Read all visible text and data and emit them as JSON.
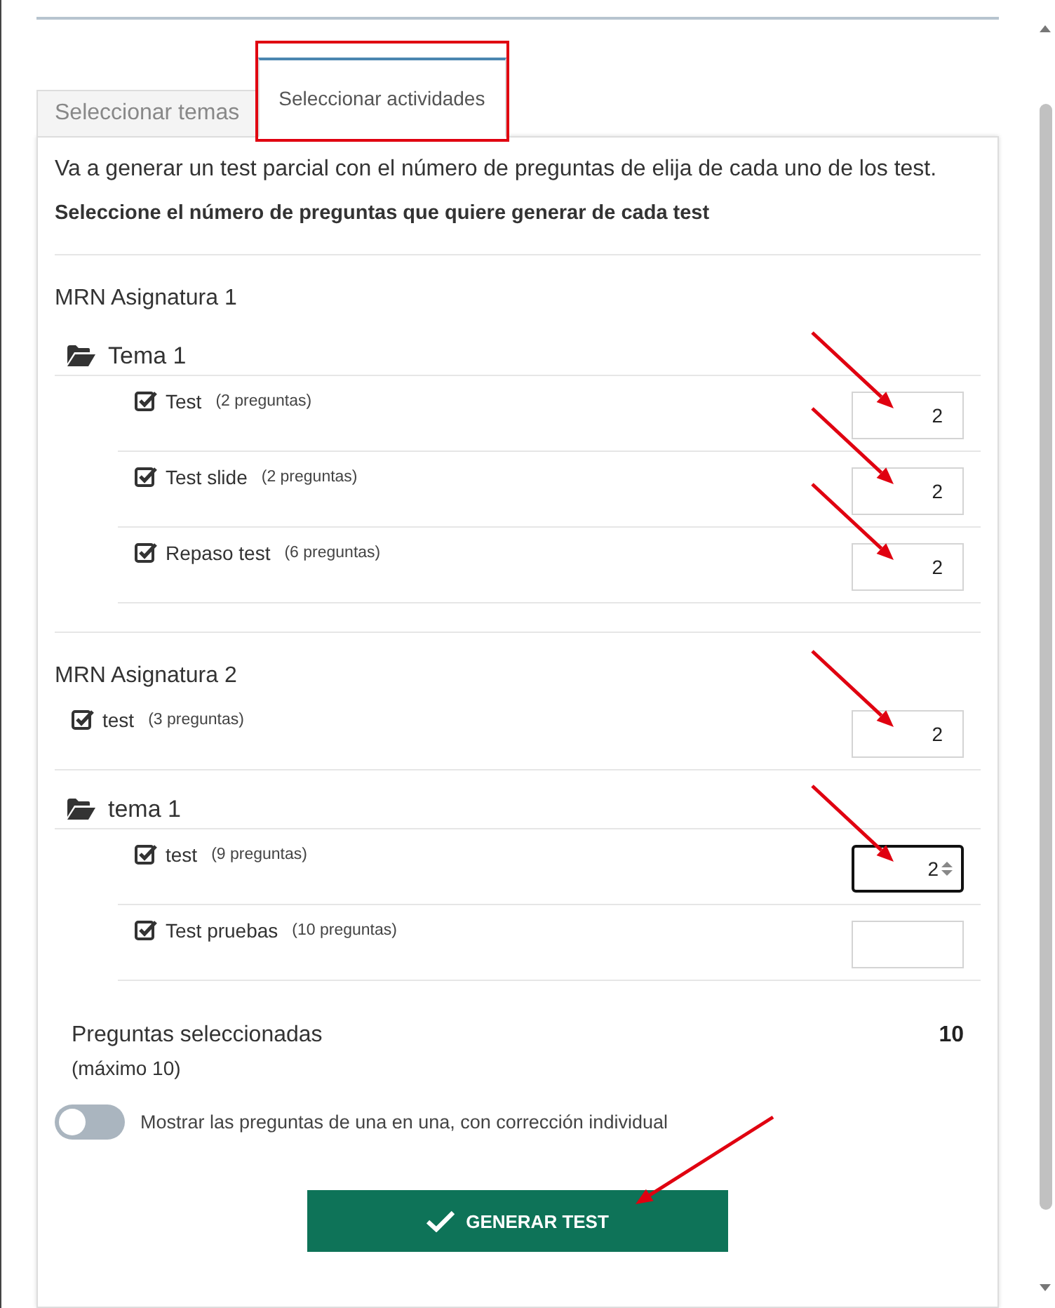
{
  "tabs": [
    {
      "label": "Seleccionar temas",
      "selected": false,
      "highlighted": false
    },
    {
      "label": "Seleccionar actividades",
      "selected": true,
      "highlighted": true
    }
  ],
  "intro": "Va a generar un test parcial con el número de preguntas de elija de cada uno de los test.",
  "instruction": "Seleccione el número de preguntas que quiere generar de cada test",
  "subjects": [
    {
      "title": "MRN Asignatura 1",
      "entries": [
        {
          "kind": "folder",
          "title": "Tema 1",
          "children": [
            {
              "label": "Test",
              "count": "(2 preguntas)",
              "checked": true,
              "value": "2",
              "focused": false,
              "arrow": true
            },
            {
              "label": "Test slide",
              "count": "(2 preguntas)",
              "checked": true,
              "value": "2",
              "focused": false,
              "arrow": true
            },
            {
              "label": "Repaso test",
              "count": "(6 preguntas)",
              "checked": true,
              "value": "2",
              "focused": false,
              "arrow": true
            }
          ]
        }
      ]
    },
    {
      "title": "MRN Asignatura 2",
      "entries": [
        {
          "kind": "activity",
          "label": "test",
          "count": "(3 preguntas)",
          "checked": true,
          "value": "2",
          "focused": false,
          "arrow": true
        },
        {
          "kind": "folder",
          "title": "tema 1",
          "children": [
            {
              "label": "test",
              "count": "(9 preguntas)",
              "checked": true,
              "value": "2",
              "focused": true,
              "arrow": true
            },
            {
              "label": "Test pruebas",
              "count": "(10 preguntas)",
              "checked": true,
              "focused": false,
              "arrow": false
            }
          ]
        }
      ]
    }
  ],
  "summary": {
    "label": "Preguntas seleccionadas",
    "total": "10",
    "note": "(máximo 10)"
  },
  "toggle": {
    "label": "Mostrar las preguntas de una en una, con corrección individual",
    "on": false
  },
  "generate_button": {
    "label": "GENERAR TEST",
    "arrow": true
  }
}
